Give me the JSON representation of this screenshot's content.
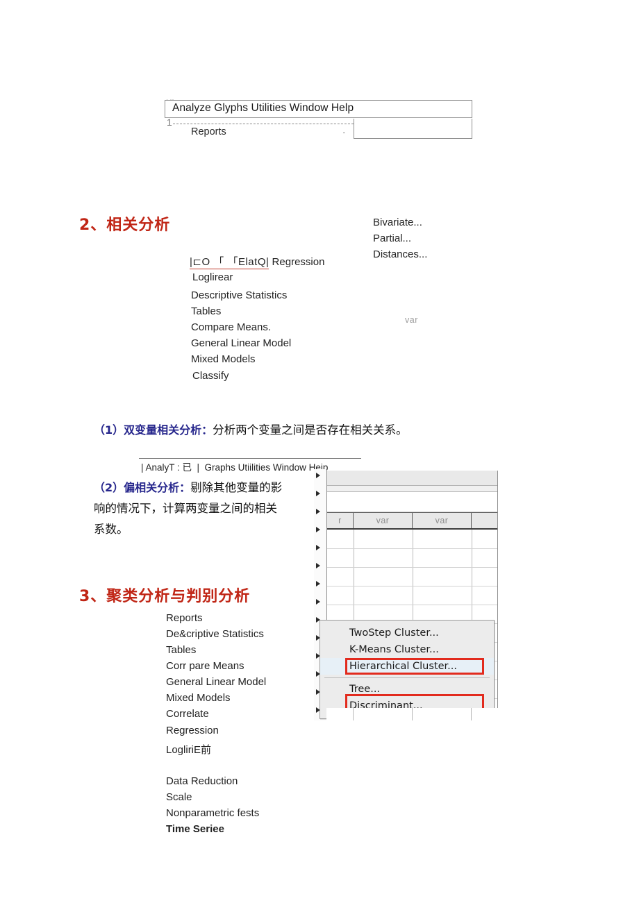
{
  "document": {
    "page_background": "#ffffff",
    "heading_color": "#c02515",
    "blue_text_color": "#26268c",
    "highlight_box_color": "#e22b1e"
  },
  "top_menu_snippet": {
    "menubar_text": "Analyze Glyphs Utilities Window Help",
    "row_number": "1",
    "first_item": "Reports",
    "submenu_dot": "·",
    "tick": "·  ··"
  },
  "section2": {
    "heading": "2、相关分析",
    "analyze_menu": {
      "odd_row_glyphs": "|⊏O 「 「ElatQ|",
      "odd_row_label": " Regression",
      "items": [
        "Loglirear",
        "Descriptive Statistics",
        "Tables",
        "Compare Means.",
        "General Linear Model",
        "Mixed Models",
        "Classify"
      ]
    },
    "correlate_submenu": {
      "items": [
        "Bivariate...",
        "Partial...",
        "Distances..."
      ]
    },
    "ghost_column_label": "var",
    "paragraphs": [
      {
        "marker": "（1）双变量相关分析：",
        "body": "分析两个变量之间是否存在相关关系。"
      },
      {
        "marker": "（2）偏相关分析：",
        "body_line1": "剔除其他变量的影",
        "body_line2": "响的情况下，计算两变量之间的相关",
        "body_line3": "系数。"
      }
    ]
  },
  "spss_window": {
    "menubar_text": "| AnalyT : 已  |  Graphs Utiilities Window Heip",
    "column_headers": [
      "r",
      "var",
      "var",
      ""
    ],
    "popup_menu": {
      "items": [
        {
          "label": "TwoStep Cluster...",
          "highlighted": false,
          "boxed": false
        },
        {
          "label": "K-Means Cluster...",
          "highlighted": false,
          "boxed": false
        },
        {
          "label": "Hierarchical Cluster...",
          "highlighted": true,
          "boxed": true
        },
        {
          "label": "Tree...",
          "highlighted": false,
          "boxed": false
        },
        {
          "label": "Discriminant...",
          "highlighted": false,
          "boxed": true
        }
      ],
      "separator_after_index": 2
    }
  },
  "section3": {
    "heading": "3、聚类分析与判别分析",
    "menu_items_group1": [
      "Reports",
      "De&criptive Statistics",
      "Tables",
      "Corr pare Means",
      "General Linear Model",
      "Mixed Models",
      "Correlate",
      "Regression",
      "LogliriE前"
    ],
    "menu_items_group2": [
      "Data Reduction",
      "Scale",
      "Nonparametric fests",
      "Time Seriee"
    ]
  }
}
